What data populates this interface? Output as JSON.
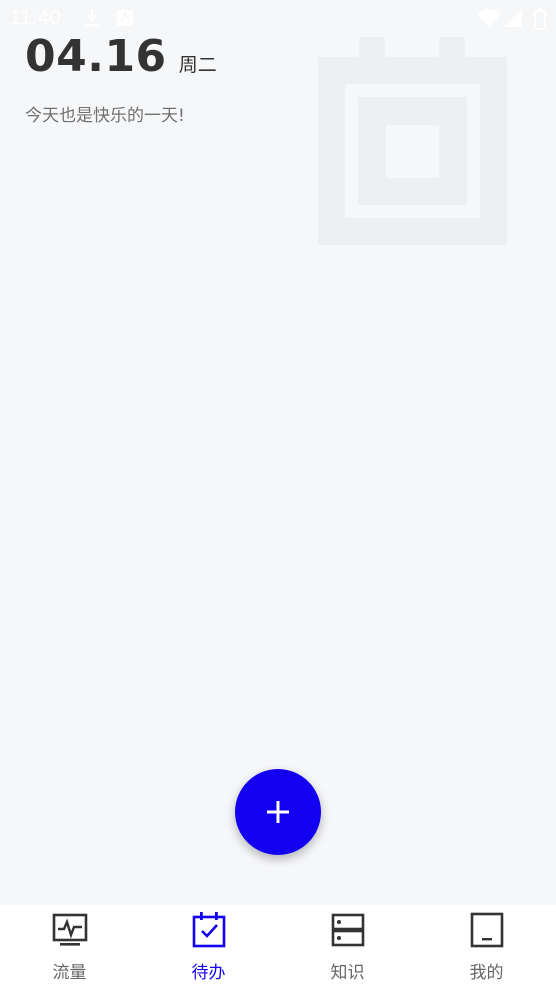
{
  "status_bar": {
    "time": "11:40",
    "icons": [
      "download-icon",
      "notification-icon",
      "wifi-icon",
      "signal-icon",
      "battery-icon"
    ]
  },
  "header": {
    "date": "04.16",
    "weekday": "周二",
    "motto": "今天也是快乐的一天!"
  },
  "fab": {
    "icon": "plus-icon",
    "color": "#1400f0"
  },
  "bottom_nav": {
    "active_color": "#1400f0",
    "inactive_color": "#333333",
    "items": [
      {
        "label": "流量",
        "icon": "traffic-monitor-icon",
        "active": false
      },
      {
        "label": "待办",
        "icon": "calendar-check-icon",
        "active": true
      },
      {
        "label": "知识",
        "icon": "knowledge-server-icon",
        "active": false
      },
      {
        "label": "我的",
        "icon": "profile-tablet-icon",
        "active": false
      }
    ]
  },
  "colors": {
    "background": "#f6f7f9",
    "watermark": "#eeeff2",
    "text_primary": "#333333",
    "text_secondary": "#707070"
  }
}
